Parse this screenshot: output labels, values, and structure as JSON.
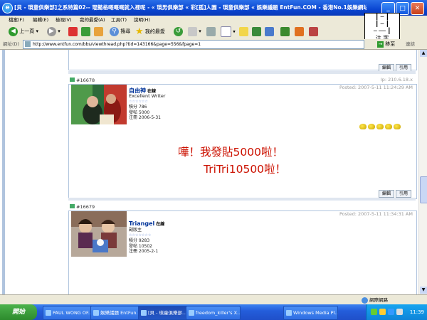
{
  "window": {
    "title": "[貝 - 瑣童俱樂部]之系特篇02-- 琨懿格嘅嘅嘅就入裡呢 - « 瑣男俱樂部 « 彩[孤]人園 - 瑣童俱樂部 « 娛樂議題 EntFun.COM - 香港No.1娛樂網站 - Microsoft Inte..."
  },
  "menu": {
    "items": [
      "檔案(F)",
      "編輯(E)",
      "檢視(V)",
      "我的最愛(A)",
      "工具(T)",
      "說明(H)"
    ]
  },
  "ime": {
    "line1": "┃ ─ ┃",
    "line2": "┃ ─ ┃",
    "line3": "─ ── ┃",
    "line4": "注 字"
  },
  "toolbar": {
    "back_label": "上一頁",
    "search_label": "搜尋",
    "favorites_label": "我的最愛"
  },
  "address": {
    "label": "網址(D)",
    "url": "http://www.entfun.com/bbs/viewthread.php?tid=143166&page=556&fpage=1",
    "go_label": "移至",
    "links_label": "連結"
  },
  "buttons": {
    "edit": "編輯",
    "quote": "引用"
  },
  "posts": [
    {
      "number": "#16678",
      "ip": "Ip: 210.6.18.x",
      "posted": "Posted: 2007-5-11 11:24:29 AM",
      "username": "自由神",
      "online": "在線",
      "title": "Excellent Writer",
      "stars": "☆☆☆☆☆☆",
      "points": "積分 786",
      "posts": "發帖 5000",
      "registered": "注冊 2006-5-31",
      "message_line1": "嘩！我發貼5000啦！",
      "message_line2": "TriTri10500啦！"
    },
    {
      "number": "#16679",
      "posted": "Posted: 2007-5-11 11:34:31 AM",
      "username": "Triangel",
      "online": "在線",
      "title": "副版主",
      "stars": "☆☆☆☆☆☆☆",
      "points": "積分 9283",
      "posts": "發帖 10502",
      "registered": "注冊 2005-2-1"
    }
  ],
  "statusbar": {
    "zone": "網際網路"
  },
  "taskbar": {
    "start": "開始",
    "tasks": [
      "PAUL WONG OF...",
      "娛樂議題 EntFun...",
      "[貝 - 瑣童俱樂部...",
      "freedom_killer's X...",
      "Windows Media Pl..."
    ],
    "clock": "11:39"
  },
  "colors": {
    "accent": "#0a46d2",
    "message": "#cc1100",
    "username": "#003399"
  }
}
